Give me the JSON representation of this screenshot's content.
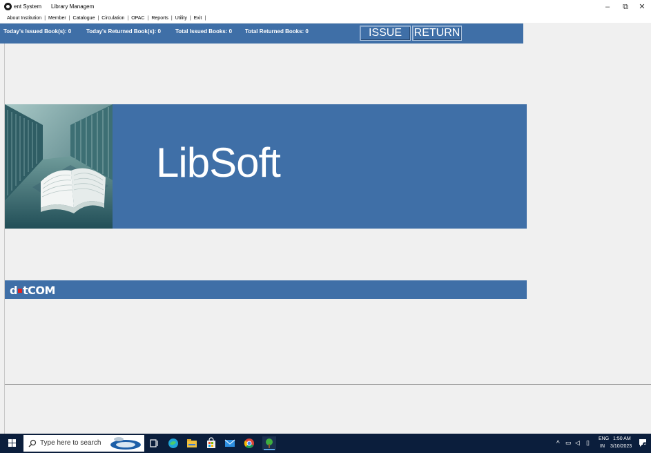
{
  "window": {
    "title_left": "ent System",
    "title_right": "Library Managem",
    "controls": {
      "minimize": "–",
      "restore": "⧉",
      "close": "✕"
    }
  },
  "menu": {
    "items": [
      "About Institution",
      "Member",
      "Catalogue",
      "Circulation",
      "OPAC",
      "Reports",
      "Utility",
      "Exit"
    ],
    "separator": "|"
  },
  "status": {
    "issued_today": "Today's Issued Book(s): 0",
    "returned_today": "Today's Returned Book(s): 0",
    "total_issued": "Total Issued Books: 0",
    "total_returned": "Total Returned Books: 0",
    "issue_button": "ISSUE",
    "return_button": "RETURN"
  },
  "banner": {
    "title": "LibSoft"
  },
  "brand": {
    "logo_prefix": "d",
    "logo_suffix": "tCOM"
  },
  "taskbar": {
    "search_placeholder": "Type here to search",
    "language_line1": "ENG",
    "language_line2": "IN",
    "time": "1:50 AM",
    "date": "3/10/2023",
    "notification_count": "2"
  },
  "colors": {
    "accent_blue": "#3f6fa7",
    "taskbar": "#0b1e3c",
    "background": "#f0f0f0"
  }
}
